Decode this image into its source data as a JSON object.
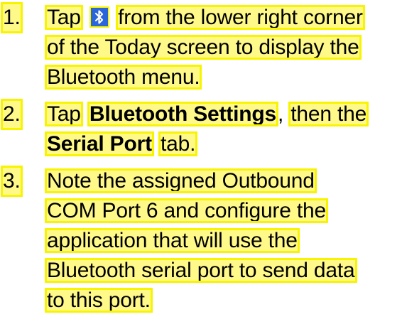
{
  "steps": [
    {
      "number": "1.",
      "lines": [
        {
          "before_icon": "Tap",
          "icon": "bluetooth-icon",
          "after_icon": "from the lower right corner"
        },
        {
          "text": "of the Today screen to display the"
        },
        {
          "text": "Bluetooth menu."
        }
      ]
    },
    {
      "number": "2.",
      "lines": [
        {
          "a": "Tap",
          "b_bold": "Bluetooth Settings",
          "c": ",",
          "d": "then the"
        },
        {
          "a_bold": "Serial Port",
          "b": "tab."
        }
      ]
    },
    {
      "number": "3.",
      "lines": [
        {
          "text": "Note the assigned Outbound"
        },
        {
          "text": "COM Port 6 and configure the"
        },
        {
          "text": "application that will use the"
        },
        {
          "text": "Bluetooth serial port to send data"
        },
        {
          "text": "to this port."
        }
      ]
    }
  ],
  "colors": {
    "highlight_fill": "#fff98a",
    "highlight_border": "#f8f400",
    "icon_background": "#2a66d9"
  }
}
